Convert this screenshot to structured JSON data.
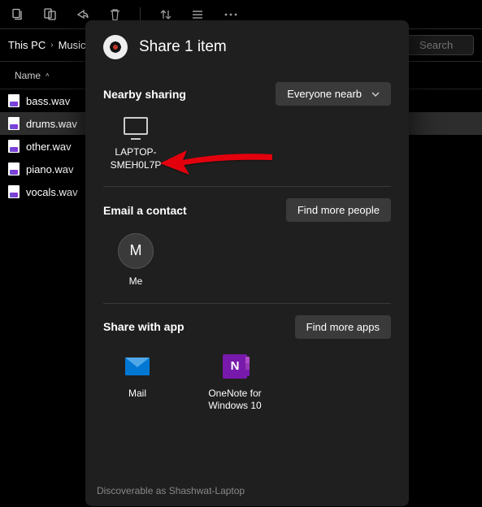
{
  "breadcrumb": {
    "root": "This PC",
    "folder": "Music"
  },
  "search": {
    "placeholder": "Search"
  },
  "columns": {
    "name": "Name"
  },
  "files": [
    {
      "name": "bass.wav"
    },
    {
      "name": "drums.wav",
      "selected": true
    },
    {
      "name": "other.wav"
    },
    {
      "name": "piano.wav"
    },
    {
      "name": "vocals.wav"
    }
  ],
  "share": {
    "title": "Share 1 item",
    "nearby": {
      "heading": "Nearby sharing",
      "scope_button": "Everyone nearb",
      "devices": [
        {
          "name": "LAPTOP-SMEH0L7P"
        }
      ]
    },
    "email": {
      "heading": "Email a contact",
      "find_button": "Find more people",
      "contacts": [
        {
          "initial": "M",
          "label": "Me"
        }
      ]
    },
    "apps": {
      "heading": "Share with app",
      "find_button": "Find more apps",
      "items": [
        {
          "label": "Mail",
          "icon": "mail"
        },
        {
          "label": "OneNote for Windows 10",
          "icon": "onenote"
        }
      ]
    },
    "footer": "Discoverable as Shashwat-Laptop"
  }
}
